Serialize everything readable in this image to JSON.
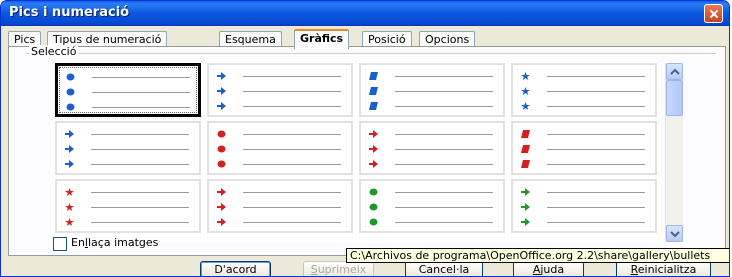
{
  "window": {
    "title": "Pics i numeració",
    "close_icon": "close-icon"
  },
  "tabs": [
    {
      "label": "Pics",
      "active": false
    },
    {
      "label": "Tipus de numeració",
      "active": false
    },
    {
      "label": "Esquema",
      "active": false
    },
    {
      "label": "Gràfics",
      "active": true
    },
    {
      "label": "Posició",
      "active": false
    },
    {
      "label": "Opcions",
      "active": false
    }
  ],
  "selection": {
    "label": "Selecció",
    "colors": {
      "blue": "#1a5fcf",
      "red": "#d42020",
      "green": "#1f9a2a"
    },
    "rows": [
      [
        {
          "icon": "blue-ball-bullet-icon",
          "color": "blue",
          "shape": "ball",
          "selected": true
        },
        {
          "icon": "blue-arrow-bullet-icon",
          "color": "blue",
          "shape": "arrow",
          "selected": false
        },
        {
          "icon": "blue-square-bullet-icon",
          "color": "blue",
          "shape": "square",
          "selected": false
        },
        {
          "icon": "blue-star-bullet-icon",
          "color": "blue",
          "shape": "star",
          "selected": false
        }
      ],
      [
        {
          "icon": "blue-arrow-bullet-icon",
          "color": "blue",
          "shape": "arrow",
          "selected": false
        },
        {
          "icon": "red-ball-bullet-icon",
          "color": "red",
          "shape": "ball",
          "selected": false
        },
        {
          "icon": "red-arrow-bullet-icon",
          "color": "red",
          "shape": "arrow",
          "selected": false
        },
        {
          "icon": "red-square-bullet-icon",
          "color": "red",
          "shape": "square",
          "selected": false
        }
      ],
      [
        {
          "icon": "red-star-bullet-icon",
          "color": "red",
          "shape": "star",
          "selected": false
        },
        {
          "icon": "red-arrow-bullet-icon",
          "color": "red",
          "shape": "arrow",
          "selected": false
        },
        {
          "icon": "green-ball-bullet-icon",
          "color": "green",
          "shape": "ball",
          "selected": false
        },
        {
          "icon": "green-arrow-bullet-icon",
          "color": "green",
          "shape": "arrow",
          "selected": false
        }
      ]
    ]
  },
  "link_images": {
    "label_prefix": "En",
    "label_mnemonic": "l",
    "label_suffix": "laça imatges",
    "checked": false
  },
  "tooltip": "C:\\Archivos de programa\\OpenOffice.org 2.2\\share\\gallery\\bullets",
  "buttons": {
    "ok": "D'acord",
    "delete_mnemonic": "S",
    "delete_rest": "uprimeix",
    "cancel": "Cancel·la",
    "help_mnemonic": "A",
    "help_rest": "juda",
    "reset_mnemonic": "R",
    "reset_rest": "einicialitza"
  }
}
